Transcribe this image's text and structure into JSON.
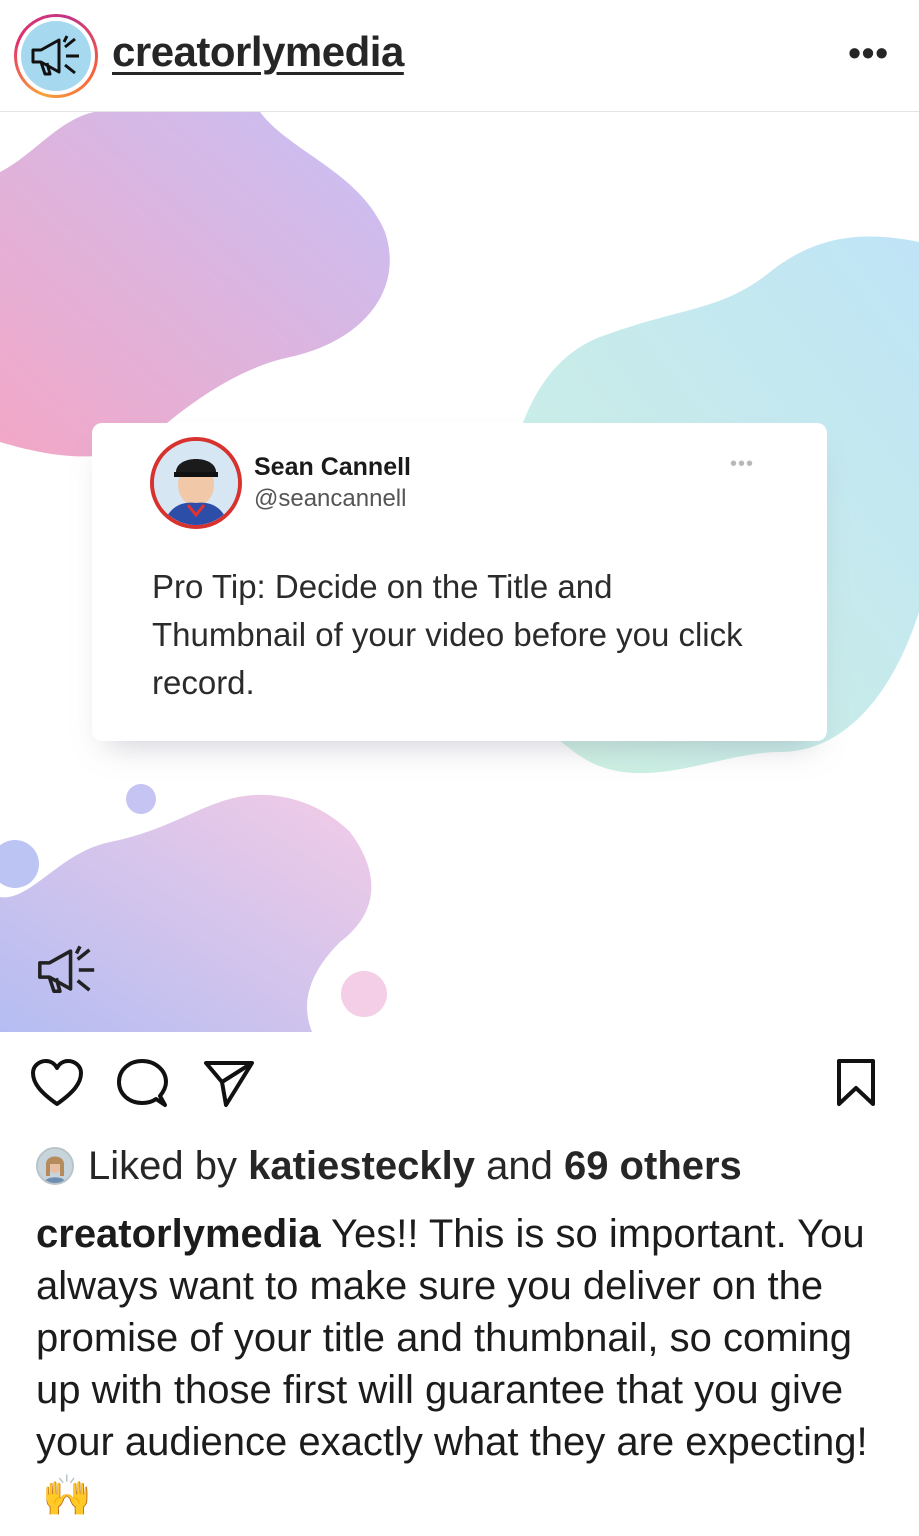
{
  "header": {
    "username": "creatorlymedia",
    "more_label": "•••",
    "avatar_icon": "megaphone-icon"
  },
  "post": {
    "tweet": {
      "name": "Sean Cannell",
      "handle": "@seancannell",
      "dots": "•••",
      "text": "Pro Tip: Decide on the Title and Thumbnail of your video before you click record."
    },
    "watermark_icon": "megaphone-icon",
    "colors": {
      "blob_pink": "#f4a8c8",
      "blob_purple": "#c6c0f6",
      "blob_blue": "#bfe6f5",
      "blob_mint": "#cdf0e2"
    }
  },
  "actions": {
    "like_icon": "heart-icon",
    "comment_icon": "comment-icon",
    "share_icon": "send-icon",
    "save_icon": "bookmark-icon"
  },
  "likes": {
    "prefix": "Liked by ",
    "user": "katiesteckly",
    "middle": " and ",
    "count": "69 others"
  },
  "caption": {
    "username": "creatorlymedia",
    "text": " Yes!! This is so important. You always want to make sure you deliver on the promise of your title and thumbnail, so coming up with those first will guarantee that you give your audience exactly what they are expecting!",
    "emoji": "🙌"
  }
}
